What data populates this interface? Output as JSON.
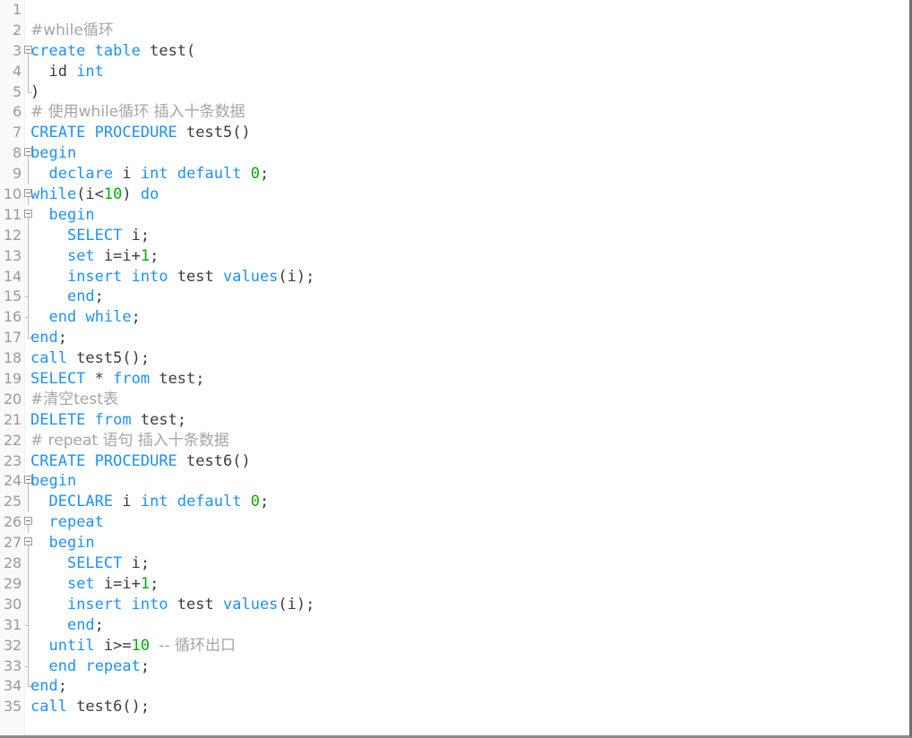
{
  "editor": {
    "name": "sql-code-editor",
    "language": "SQL",
    "total_lines": 35,
    "colors": {
      "background": "#ffffff",
      "gutter_background": "#fafafa",
      "line_number": "#999999",
      "keyword": "#1e90ff",
      "number": "#00b000",
      "comment": "#a5a5a5",
      "plain_text": "#3c3c3c",
      "fold_line": "#b9b9b9",
      "border_right": "#6f6f6f",
      "border_bottom": "#8a8a8a"
    }
  },
  "lines": [
    {
      "n": "1",
      "fold": "none",
      "tokens": []
    },
    {
      "n": "2",
      "fold": "none",
      "tokens": [
        {
          "t": "#while循环",
          "c": "cmt"
        }
      ]
    },
    {
      "n": "3",
      "fold": "start",
      "tokens": [
        {
          "t": "create",
          "c": "kw"
        },
        {
          "t": " ",
          "c": "plain"
        },
        {
          "t": "table",
          "c": "kw"
        },
        {
          "t": " test(",
          "c": "plain"
        }
      ]
    },
    {
      "n": "4",
      "fold": "line",
      "tokens": [
        {
          "t": "  id ",
          "c": "plain"
        },
        {
          "t": "int",
          "c": "kw"
        }
      ]
    },
    {
      "n": "5",
      "fold": "end",
      "tokens": [
        {
          "t": ")",
          "c": "plain"
        }
      ]
    },
    {
      "n": "6",
      "fold": "none",
      "tokens": [
        {
          "t": "# 使用while循环 插入十条数据",
          "c": "cmt"
        }
      ]
    },
    {
      "n": "7",
      "fold": "none",
      "tokens": [
        {
          "t": "CREATE",
          "c": "kw"
        },
        {
          "t": " ",
          "c": "plain"
        },
        {
          "t": "PROCEDURE",
          "c": "kw"
        },
        {
          "t": " test5()",
          "c": "plain"
        }
      ]
    },
    {
      "n": "8",
      "fold": "start",
      "tokens": [
        {
          "t": "begin",
          "c": "kw"
        }
      ]
    },
    {
      "n": "9",
      "fold": "line",
      "tokens": [
        {
          "t": "  ",
          "c": "plain"
        },
        {
          "t": "declare",
          "c": "kw"
        },
        {
          "t": " i ",
          "c": "plain"
        },
        {
          "t": "int",
          "c": "kw"
        },
        {
          "t": " ",
          "c": "plain"
        },
        {
          "t": "default",
          "c": "kw"
        },
        {
          "t": " ",
          "c": "plain"
        },
        {
          "t": "0",
          "c": "num"
        },
        {
          "t": ";",
          "c": "plain"
        }
      ]
    },
    {
      "n": "10",
      "fold": "start",
      "tokens": [
        {
          "t": "while",
          "c": "kw"
        },
        {
          "t": "(i<",
          "c": "plain"
        },
        {
          "t": "10",
          "c": "num"
        },
        {
          "t": ") ",
          "c": "plain"
        },
        {
          "t": "do",
          "c": "kw"
        }
      ]
    },
    {
      "n": "11",
      "fold": "start",
      "tokens": [
        {
          "t": "  ",
          "c": "plain"
        },
        {
          "t": "begin",
          "c": "kw"
        }
      ]
    },
    {
      "n": "12",
      "fold": "line",
      "tokens": [
        {
          "t": "    ",
          "c": "plain"
        },
        {
          "t": "SELECT",
          "c": "kw"
        },
        {
          "t": " i;",
          "c": "plain"
        }
      ]
    },
    {
      "n": "13",
      "fold": "line",
      "tokens": [
        {
          "t": "    ",
          "c": "plain"
        },
        {
          "t": "set",
          "c": "kw"
        },
        {
          "t": " i=i+",
          "c": "plain"
        },
        {
          "t": "1",
          "c": "num"
        },
        {
          "t": ";",
          "c": "plain"
        }
      ]
    },
    {
      "n": "14",
      "fold": "line",
      "tokens": [
        {
          "t": "    ",
          "c": "plain"
        },
        {
          "t": "insert",
          "c": "kw"
        },
        {
          "t": " ",
          "c": "plain"
        },
        {
          "t": "into",
          "c": "kw"
        },
        {
          "t": " test ",
          "c": "plain"
        },
        {
          "t": "values",
          "c": "kw"
        },
        {
          "t": "(i);",
          "c": "plain"
        }
      ]
    },
    {
      "n": "15",
      "fold": "tick",
      "tokens": [
        {
          "t": "    ",
          "c": "plain"
        },
        {
          "t": "end",
          "c": "kw"
        },
        {
          "t": ";",
          "c": "plain"
        }
      ]
    },
    {
      "n": "16",
      "fold": "tick",
      "tokens": [
        {
          "t": "  ",
          "c": "plain"
        },
        {
          "t": "end",
          "c": "kw"
        },
        {
          "t": " ",
          "c": "plain"
        },
        {
          "t": "while",
          "c": "kw"
        },
        {
          "t": ";",
          "c": "plain"
        }
      ]
    },
    {
      "n": "17",
      "fold": "end",
      "tokens": [
        {
          "t": "end",
          "c": "kw"
        },
        {
          "t": ";",
          "c": "plain"
        }
      ]
    },
    {
      "n": "18",
      "fold": "none",
      "tokens": [
        {
          "t": "call",
          "c": "kw"
        },
        {
          "t": " test5();",
          "c": "plain"
        }
      ]
    },
    {
      "n": "19",
      "fold": "none",
      "tokens": [
        {
          "t": "SELECT",
          "c": "kw"
        },
        {
          "t": " * ",
          "c": "plain"
        },
        {
          "t": "from",
          "c": "kw"
        },
        {
          "t": " test;",
          "c": "plain"
        }
      ]
    },
    {
      "n": "20",
      "fold": "none",
      "tokens": [
        {
          "t": "#清空test表",
          "c": "cmt"
        }
      ]
    },
    {
      "n": "21",
      "fold": "none",
      "tokens": [
        {
          "t": "DELETE",
          "c": "kw"
        },
        {
          "t": " ",
          "c": "plain"
        },
        {
          "t": "from",
          "c": "kw"
        },
        {
          "t": " test;",
          "c": "plain"
        }
      ]
    },
    {
      "n": "22",
      "fold": "none",
      "tokens": [
        {
          "t": "# repeat 语句 插入十条数据",
          "c": "cmt"
        }
      ]
    },
    {
      "n": "23",
      "fold": "none",
      "tokens": [
        {
          "t": "CREATE",
          "c": "kw"
        },
        {
          "t": " ",
          "c": "plain"
        },
        {
          "t": "PROCEDURE",
          "c": "kw"
        },
        {
          "t": " test6()",
          "c": "plain"
        }
      ]
    },
    {
      "n": "24",
      "fold": "start",
      "tokens": [
        {
          "t": "begin",
          "c": "kw"
        }
      ]
    },
    {
      "n": "25",
      "fold": "line",
      "tokens": [
        {
          "t": "  ",
          "c": "plain"
        },
        {
          "t": "DECLARE",
          "c": "kw"
        },
        {
          "t": " i ",
          "c": "plain"
        },
        {
          "t": "int",
          "c": "kw"
        },
        {
          "t": " ",
          "c": "plain"
        },
        {
          "t": "default",
          "c": "kw"
        },
        {
          "t": " ",
          "c": "plain"
        },
        {
          "t": "0",
          "c": "num"
        },
        {
          "t": ";",
          "c": "plain"
        }
      ]
    },
    {
      "n": "26",
      "fold": "start-indent",
      "tokens": [
        {
          "t": "  ",
          "c": "plain"
        },
        {
          "t": "repeat",
          "c": "kw"
        }
      ]
    },
    {
      "n": "27",
      "fold": "start-indent",
      "tokens": [
        {
          "t": "  ",
          "c": "plain"
        },
        {
          "t": "begin",
          "c": "kw"
        }
      ]
    },
    {
      "n": "28",
      "fold": "line",
      "tokens": [
        {
          "t": "    ",
          "c": "plain"
        },
        {
          "t": "SELECT",
          "c": "kw"
        },
        {
          "t": " i;",
          "c": "plain"
        }
      ]
    },
    {
      "n": "29",
      "fold": "line",
      "tokens": [
        {
          "t": "    ",
          "c": "plain"
        },
        {
          "t": "set",
          "c": "kw"
        },
        {
          "t": " i=i+",
          "c": "plain"
        },
        {
          "t": "1",
          "c": "num"
        },
        {
          "t": ";",
          "c": "plain"
        }
      ]
    },
    {
      "n": "30",
      "fold": "line",
      "tokens": [
        {
          "t": "    ",
          "c": "plain"
        },
        {
          "t": "insert",
          "c": "kw"
        },
        {
          "t": " ",
          "c": "plain"
        },
        {
          "t": "into",
          "c": "kw"
        },
        {
          "t": " test ",
          "c": "plain"
        },
        {
          "t": "values",
          "c": "kw"
        },
        {
          "t": "(i);",
          "c": "plain"
        }
      ]
    },
    {
      "n": "31",
      "fold": "tick",
      "tokens": [
        {
          "t": "    ",
          "c": "plain"
        },
        {
          "t": "end",
          "c": "kw"
        },
        {
          "t": ";",
          "c": "plain"
        }
      ]
    },
    {
      "n": "32",
      "fold": "line",
      "tokens": [
        {
          "t": "  ",
          "c": "plain"
        },
        {
          "t": "until",
          "c": "kw"
        },
        {
          "t": " i>=",
          "c": "plain"
        },
        {
          "t": "10",
          "c": "num"
        },
        {
          "t": " ",
          "c": "plain"
        },
        {
          "t": "-- 循环出口",
          "c": "cmt"
        }
      ]
    },
    {
      "n": "33",
      "fold": "tick",
      "tokens": [
        {
          "t": "  ",
          "c": "plain"
        },
        {
          "t": "end",
          "c": "kw"
        },
        {
          "t": " ",
          "c": "plain"
        },
        {
          "t": "repeat",
          "c": "kw"
        },
        {
          "t": ";",
          "c": "plain"
        }
      ]
    },
    {
      "n": "34",
      "fold": "end",
      "tokens": [
        {
          "t": "end",
          "c": "kw"
        },
        {
          "t": ";",
          "c": "plain"
        }
      ]
    },
    {
      "n": "35",
      "fold": "none",
      "tokens": [
        {
          "t": "call",
          "c": "kw"
        },
        {
          "t": " test6();",
          "c": "plain"
        }
      ]
    }
  ]
}
